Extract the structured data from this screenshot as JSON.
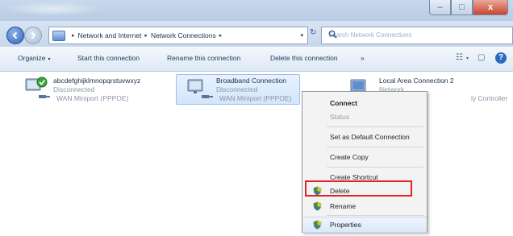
{
  "window": {
    "caption_buttons": {
      "minimize": "–",
      "maximize": "□",
      "close": "x"
    }
  },
  "address_bar": {
    "recent_pages_glyph": "▾",
    "crumbs": [
      "Network and Internet",
      "Network Connections"
    ],
    "crumb_sep": "▸",
    "lead_sep": "▸",
    "dropdown": "▾",
    "refresh": "↻",
    "search_placeholder": "Search Network Connections",
    "search_icon": "⚲"
  },
  "command_bar": {
    "organize": "Organize",
    "dropdown": "▾",
    "start": "Start this connection",
    "rename": "Rename this connection",
    "delete": "Delete this connection",
    "more": "»",
    "views_glyph": "☷",
    "preview_glyph": "▢",
    "help": "?"
  },
  "connections": [
    {
      "name": "abcdefghijklmnopqrstuvwxyz",
      "status": "Disconnected",
      "device": "WAN Miniport (PPPOE)",
      "icon": "dialup-connection-icon"
    },
    {
      "name": "Broadband Connection",
      "status": "Disconnected",
      "device": "WAN Miniport (PPPOE)",
      "icon": "broadband-connection-icon"
    },
    {
      "name": "Local Area Connection 2",
      "status": "Network",
      "device": "ly Controller",
      "icon": "lan-connection-icon"
    }
  ],
  "context_menu": {
    "items": [
      {
        "label": "Connect",
        "bold": true
      },
      {
        "label": "Status",
        "disabled": true
      },
      {
        "label": "Set as Default Connection"
      },
      {
        "label": "Create Copy"
      },
      {
        "label": "Create Shortcut"
      },
      {
        "label": "Delete"
      },
      {
        "label": "Rename"
      },
      {
        "label": "Properties"
      }
    ]
  },
  "colors": {
    "accent": "#2b6ac1",
    "highlight_box": "#e0242a",
    "selection": "#d3e5fb"
  }
}
